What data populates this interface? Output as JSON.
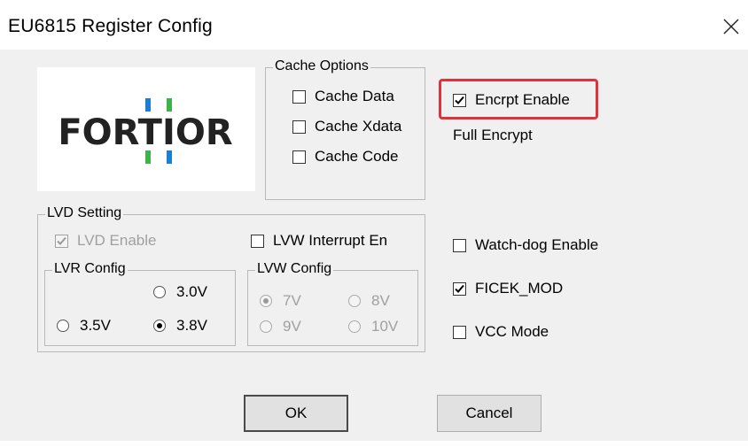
{
  "window": {
    "title": "EU6815 Register Config"
  },
  "logo": {
    "text": "FORTIOR"
  },
  "cache_options": {
    "label": "Cache Options",
    "items": [
      {
        "label": "Cache Data",
        "checked": false
      },
      {
        "label": "Cache Xdata",
        "checked": false
      },
      {
        "label": "Cache Code",
        "checked": false
      }
    ]
  },
  "encrypt": {
    "label": "Encrpt Enable",
    "checked": true,
    "mode_text": "Full Encrypt",
    "highlight_color": "#e0323a"
  },
  "lvd_setting": {
    "label": "LVD Setting",
    "lvd_enable": {
      "label": "LVD Enable",
      "checked": true,
      "disabled": true
    },
    "lvw_interrupt": {
      "label": "LVW Interrupt En",
      "checked": false
    },
    "lvr_config": {
      "label": "LVR Config",
      "options": [
        "3.0V",
        "3.5V",
        "3.8V"
      ],
      "selected": "3.8V"
    },
    "lvw_config": {
      "label": "LVW Config",
      "options": [
        "7V",
        "8V",
        "9V",
        "10V"
      ],
      "selected": "7V",
      "disabled": true
    }
  },
  "options": {
    "watchdog": {
      "label": "Watch-dog Enable",
      "checked": false
    },
    "ficek_mod": {
      "label": "FICEK_MOD",
      "checked": true
    },
    "vcc_mode": {
      "label": "VCC Mode",
      "checked": false
    }
  },
  "buttons": {
    "ok": "OK",
    "cancel": "Cancel"
  },
  "colors": {
    "logo_blue": "#1a7fd4",
    "logo_green": "#3cb44a",
    "logo_dark": "#222222"
  }
}
